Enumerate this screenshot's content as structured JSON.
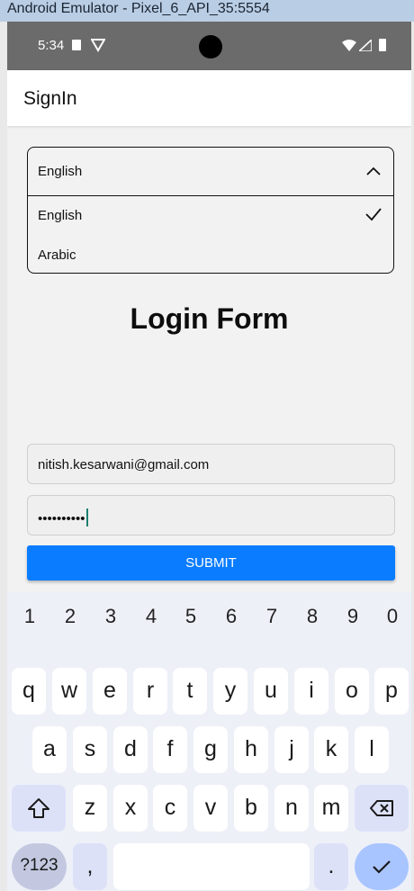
{
  "window": {
    "title": "Android Emulator - Pixel_6_API_35:5554"
  },
  "status_bar": {
    "time": "5:34"
  },
  "app_bar": {
    "title": "SignIn"
  },
  "language_dropdown": {
    "selected": "English",
    "options": [
      {
        "label": "English",
        "checked": true
      },
      {
        "label": "Arabic",
        "checked": false
      }
    ]
  },
  "form": {
    "title": "Login Form",
    "email_value": "nitish.kesarwani@gmail.com",
    "password_value": "••••••••••",
    "submit_label": "SUBMIT"
  },
  "keyboard": {
    "numbers": [
      "1",
      "2",
      "3",
      "4",
      "5",
      "6",
      "7",
      "8",
      "9",
      "0"
    ],
    "row1": [
      "q",
      "w",
      "e",
      "r",
      "t",
      "y",
      "u",
      "i",
      "o",
      "p"
    ],
    "row2": [
      "a",
      "s",
      "d",
      "f",
      "g",
      "h",
      "j",
      "k",
      "l"
    ],
    "row3": [
      "z",
      "x",
      "c",
      "v",
      "b",
      "n",
      "m"
    ],
    "symbols_label": "?123",
    "comma_label": ",",
    "period_label": "."
  },
  "colors": {
    "accent": "#0a7cff",
    "status_bar": "#6b6b6b",
    "enter_key": "#a9c5ff"
  }
}
